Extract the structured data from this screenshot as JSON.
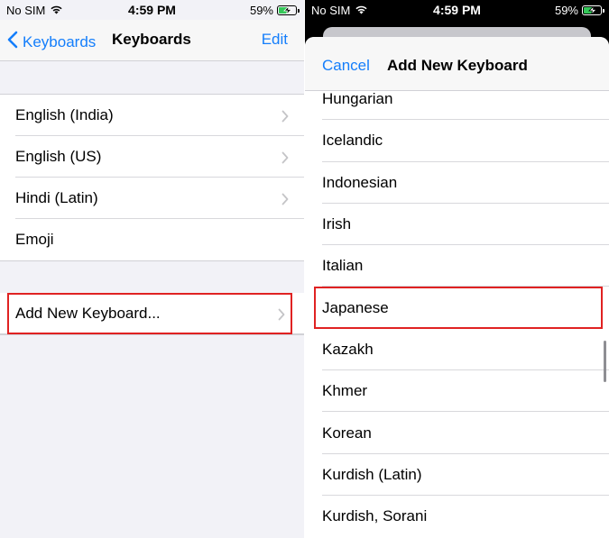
{
  "left": {
    "status": {
      "carrier": "No SIM",
      "time": "4:59 PM",
      "battery": "59%",
      "battery_level": 0.59
    },
    "nav": {
      "back_label": "Keyboards",
      "title": "Keyboards",
      "edit_label": "Edit"
    },
    "keyboards": [
      {
        "label": "English (India)",
        "chevron": true
      },
      {
        "label": "English (US)",
        "chevron": true
      },
      {
        "label": "Hindi (Latin)",
        "chevron": true
      },
      {
        "label": "Emoji",
        "chevron": false
      }
    ],
    "add_keyboard": {
      "label": "Add New Keyboard..."
    }
  },
  "right": {
    "status": {
      "carrier": "No SIM",
      "time": "4:59 PM",
      "battery": "59%",
      "battery_level": 0.59
    },
    "sheet": {
      "cancel_label": "Cancel",
      "title": "Add New Keyboard"
    },
    "languages": [
      "Hungarian",
      "Icelandic",
      "Indonesian",
      "Irish",
      "Italian",
      "Japanese",
      "Kazakh",
      "Khmer",
      "Korean",
      "Kurdish (Latin)",
      "Kurdish, Sorani"
    ],
    "highlighted": "Japanese"
  },
  "colors": {
    "accent": "#147efb",
    "highlight": "#e02222",
    "battery_charging": "#34c759"
  }
}
